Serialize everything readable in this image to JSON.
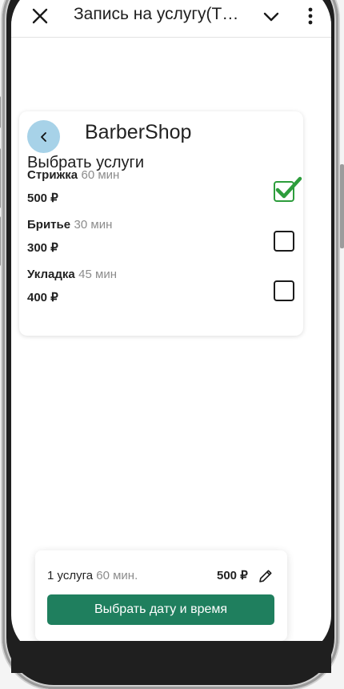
{
  "app_bar": {
    "title": "Запись на услугу(Т…",
    "close_icon": "close-icon",
    "dropdown_icon": "chevron-down-icon",
    "menu_icon": "more-vert-icon"
  },
  "card": {
    "shop_name": "BarberShop",
    "section_title": "Выбрать услуги",
    "services": [
      {
        "name": "Стрижка",
        "duration": "60 мин",
        "price": "500 ₽",
        "selected": true
      },
      {
        "name": "Бритье",
        "duration": "30 мин",
        "price": "300 ₽",
        "selected": false
      },
      {
        "name": "Укладка",
        "duration": "45 мин",
        "price": "400 ₽",
        "selected": false
      }
    ]
  },
  "summary": {
    "count": "1 услуга",
    "minutes": "60 мин.",
    "total": "500 ₽",
    "cta": "Выбрать дату и время"
  },
  "colors": {
    "accent": "#1f7f5e",
    "check": "#2d9d3c",
    "back_button": "#a7d2e8"
  }
}
